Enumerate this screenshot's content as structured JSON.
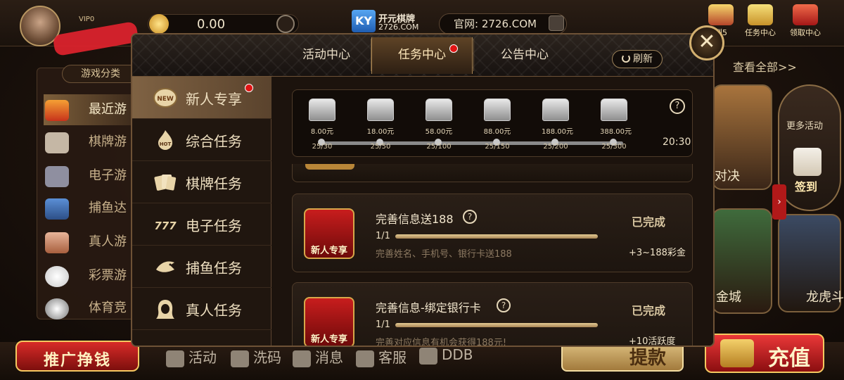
{
  "lobby": {
    "vip": "VIP0",
    "balance": "0.00",
    "brand": "开元棋牌",
    "brand_domain": "2726.COM",
    "website": "官网: 2726.COM",
    "top_icons": [
      {
        "label": "到5",
        "icon": "lucky-wheel-icon"
      },
      {
        "label": "任务中心",
        "icon": "task-icon"
      },
      {
        "label": "领取中心",
        "icon": "gift-icon"
      }
    ],
    "game_category_title": "游戏分类",
    "side_items": [
      {
        "label": "最近游",
        "icon": "flame-icon"
      },
      {
        "label": "棋牌游",
        "icon": "cards-icon"
      },
      {
        "label": "电子游",
        "icon": "slot-icon"
      },
      {
        "label": "捕鱼达",
        "icon": "fish-icon"
      },
      {
        "label": "真人游",
        "icon": "dealer-icon"
      },
      {
        "label": "彩票游",
        "icon": "lottery-ball-icon"
      },
      {
        "label": "体育竞",
        "icon": "soccer-ball-icon"
      }
    ],
    "view_all": "查看全部>>",
    "games": [
      {
        "label": "对决"
      },
      {
        "label": "金城"
      },
      {
        "label": "龙虎斗"
      }
    ],
    "more_activity": "更多活动",
    "sign_in": "签到",
    "bottom": {
      "promo": "推广挣钱",
      "items": [
        {
          "label": "活动",
          "icon": "grid-icon"
        },
        {
          "label": "洗码",
          "icon": "bars-icon"
        },
        {
          "label": "消息",
          "icon": "mail-icon"
        },
        {
          "label": "客服",
          "icon": "headset-icon"
        },
        {
          "label": "DDB",
          "icon": "d-icon"
        }
      ],
      "withdraw": "提款",
      "recharge": "充值"
    }
  },
  "modal": {
    "tabs": [
      {
        "label": "活动中心",
        "active": false
      },
      {
        "label": "任务中心",
        "active": true,
        "dot": true
      },
      {
        "label": "公告中心",
        "active": false
      }
    ],
    "refresh": "刷新",
    "close": "✕",
    "categories": [
      {
        "label": "新人专享",
        "icon": "new-badge-icon",
        "active": true,
        "dot": true
      },
      {
        "label": "综合任务",
        "icon": "hot-flame-icon"
      },
      {
        "label": "棋牌任务",
        "icon": "playing-cards-icon"
      },
      {
        "label": "电子任务",
        "icon": "seven-seven-seven-icon"
      },
      {
        "label": "捕鱼任务",
        "icon": "shark-icon"
      },
      {
        "label": "真人任务",
        "icon": "woman-icon"
      }
    ],
    "rewards": {
      "chests": [
        {
          "amount": "8.00元",
          "progress": "25/30"
        },
        {
          "amount": "18.00元",
          "progress": "25/50"
        },
        {
          "amount": "58.00元",
          "progress": "25/100"
        },
        {
          "amount": "88.00元",
          "progress": "25/150"
        },
        {
          "amount": "188.00元",
          "progress": "25/200"
        },
        {
          "amount": "388.00元",
          "progress": "25/300"
        }
      ],
      "help": "?",
      "timer": "20:30"
    },
    "tasks": [
      {
        "icon_tag": "新人专享",
        "title": "完善信息送188",
        "count": "1/1",
        "progress": 1.0,
        "desc": "完善姓名、手机号、银行卡送188",
        "status": "已完成",
        "reward": "+3~188彩金"
      },
      {
        "icon_tag": "新人专享",
        "title": "完善信息-绑定银行卡",
        "count": "1/1",
        "progress": 1.0,
        "desc": "完善对应信息有机会获得188元!",
        "status": "已完成",
        "reward": "+10活跃度"
      }
    ]
  },
  "colors": {
    "accent_gold": "#d3b070",
    "badge_red": "#e11414",
    "brand_red": "#c81d1d"
  }
}
